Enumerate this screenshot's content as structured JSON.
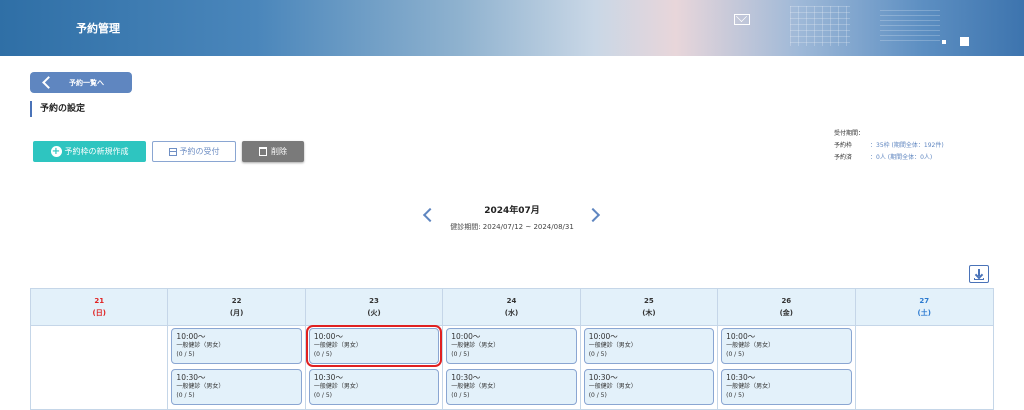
{
  "header": {
    "title": "予約管理"
  },
  "back": {
    "label": "予約一覧へ"
  },
  "section": {
    "title": "予約の設定"
  },
  "actions": {
    "new_label": "予約枠の新規作成",
    "accept_label": "予約の受付",
    "delete_label": "削除"
  },
  "info": {
    "period_label": "受付期間：",
    "slots_key": "予約枠",
    "slots_val": "：35枠 (期間全体：192件)",
    "booked_key": "予約済",
    "booked_val": "：0人 (期間全体：0人)"
  },
  "calendar": {
    "month": "2024年07月",
    "period": "健診期間: 2024/07/12 ~ 2024/08/31",
    "days": [
      {
        "date": "21",
        "dow": "(日)"
      },
      {
        "date": "22",
        "dow": "(月)"
      },
      {
        "date": "23",
        "dow": "(火)"
      },
      {
        "date": "24",
        "dow": "(水)"
      },
      {
        "date": "25",
        "dow": "(木)"
      },
      {
        "date": "26",
        "dow": "(金)"
      },
      {
        "date": "27",
        "dow": "(土)"
      }
    ],
    "slot_type": "一般健診（男女）",
    "slot_count": "(0 / 5)",
    "times": [
      "10:00～",
      "10:30～"
    ]
  },
  "colors": {
    "accent": "#5f86c0",
    "teal": "#2ec5c0",
    "sunday": "#e02020",
    "saturday": "#2b7ad0",
    "selected": "#e02020"
  }
}
